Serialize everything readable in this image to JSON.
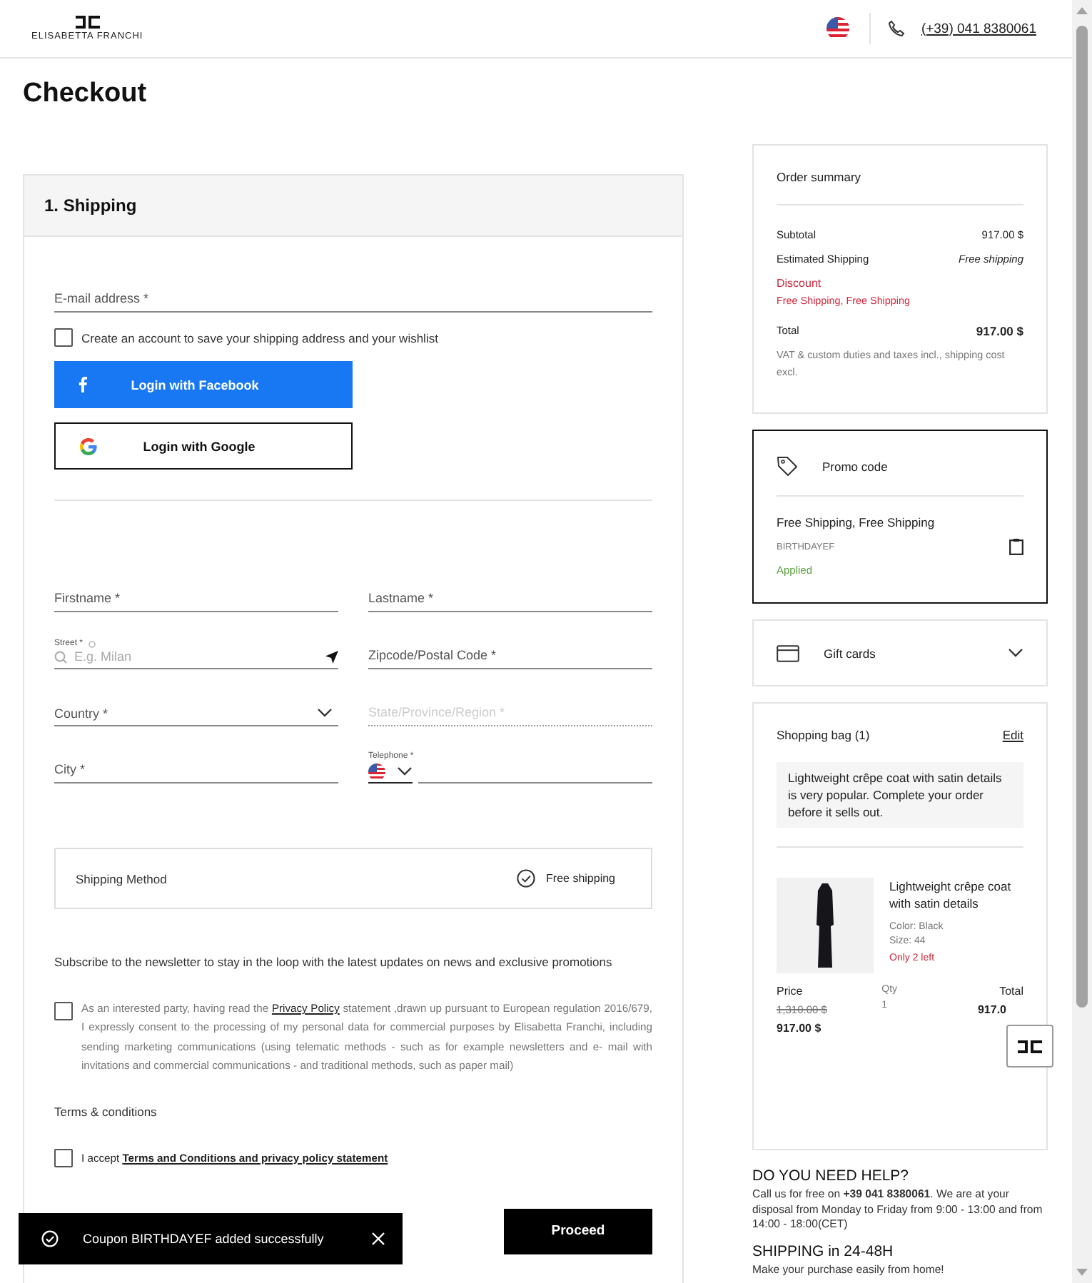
{
  "header": {
    "logo_text": "ELISABETTA FRANCHI",
    "phone": "(+39) 041 8380061"
  },
  "page_title": "Checkout",
  "shipping": {
    "title": "1. Shipping",
    "email": {
      "placeholder": "E-mail address *"
    },
    "create_account": {
      "label": "Create an account to save your shipping address and your wishlist",
      "checked": false
    },
    "social_buttons": [
      {
        "kind": "facebook",
        "label": "Login with Facebook"
      },
      {
        "kind": "google",
        "label": "Login with Google"
      }
    ],
    "fields": [
      {
        "kind": "text",
        "placeholder": "Firstname *",
        "disabled": false
      },
      {
        "kind": "street",
        "label": "Street *",
        "placeholder": "E.g. Milan",
        "disabled": false
      },
      {
        "kind": "select",
        "label": "Country *",
        "disabled": false
      },
      {
        "kind": "text",
        "placeholder": "City *",
        "disabled": false
      },
      {
        "kind": "text",
        "placeholder": "Lastname *",
        "disabled": false
      },
      {
        "kind": "text",
        "placeholder": "Zipcode/Postal Code *",
        "disabled": false
      },
      {
        "kind": "text",
        "placeholder": "State/Province/Region *",
        "disabled": true
      },
      {
        "kind": "phone",
        "label": "Telephone *",
        "disabled": false
      }
    ],
    "shipping_method": {
      "label": "Shipping Method",
      "option": "Free shipping",
      "selected": true
    },
    "newsletter_text": "Subscribe to the newsletter to stay in the loop with the latest updates on news and exclusive promotions",
    "consent": {
      "checked": false,
      "text_before": "As an interested party, having read the",
      "link": "Privacy Policy",
      "text_after": "statement ,drawn up pursuant to European regulation 2016/679, I expressly consent to the processing of my personal data for commercial purposes by Elisabetta Franchi, including sending marketing communications (using telematic methods - such as for example newsletters and e- mail with invitations and commercial communications - and traditional methods, such as paper mail)"
    },
    "terms_heading": "Terms & conditions",
    "terms": {
      "checked": false,
      "prefix": "I accept",
      "link": "Terms and Conditions and privacy policy statement"
    },
    "proceed": "Proceed"
  },
  "order_summary": {
    "title": "Order summary",
    "rows": [
      {
        "kind": "normal",
        "label": "Subtotal",
        "value": "917.00 $"
      },
      {
        "kind": "shipping",
        "label": "Estimated Shipping",
        "value": "Free shipping"
      },
      {
        "kind": "discount",
        "label": "Discount",
        "value": "Free Shipping, Free Shipping"
      },
      {
        "kind": "total",
        "label": "Total",
        "value": "917.00 $"
      }
    ],
    "note": "VAT & custom duties and taxes incl., shipping cost excl."
  },
  "promo": {
    "title": "Promo code",
    "name": "Free Shipping, Free Shipping",
    "code": "BIRTHDAYEF",
    "status": "Applied"
  },
  "gift_cards": {
    "title": "Gift cards",
    "expanded": false
  },
  "bag": {
    "title": "Shopping bag (1)",
    "edit": "Edit",
    "notice": "Lightweight crêpe coat with satin details is very popular. Complete your order before it sells out.",
    "item": {
      "name": "Lightweight crêpe coat with satin details",
      "color_text": "Color: Black",
      "size": "Size: 44",
      "stock": "Only 2 left",
      "price_label": "Price",
      "old_price": "1,310.00 $",
      "price": "917.00 $",
      "qty_label": "Qty",
      "qty": "1",
      "total_label": "Total",
      "total": "917.0"
    }
  },
  "help": [
    {
      "title": "DO YOU NEED HELP?",
      "text": "Call us for free on **+39 041 8380061**. We are at your disposal from Monday to Friday from 9:00 - 13:00 and from 14:00 - 18:00(CET)"
    },
    {
      "title": "SHIPPING in 24-48H",
      "text": "Make your purchase easily from home!"
    }
  ],
  "toast": {
    "message": "Coupon BIRTHDAYEF added successfully"
  }
}
